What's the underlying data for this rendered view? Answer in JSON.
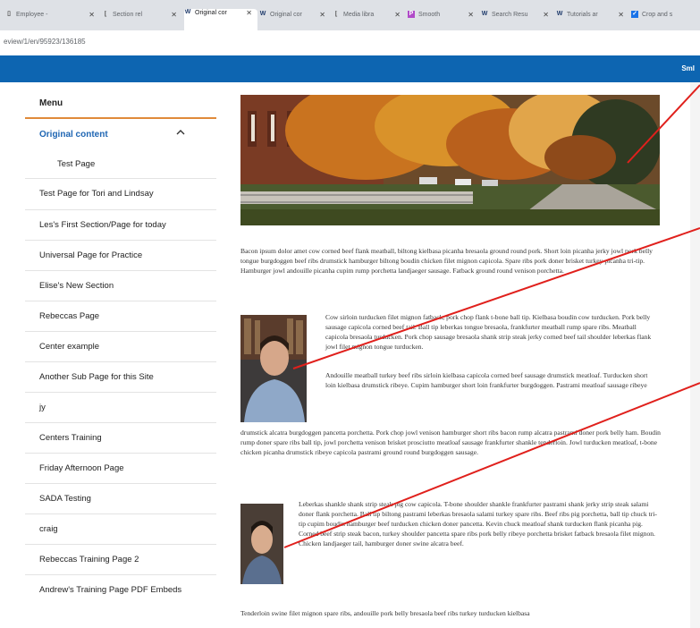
{
  "browser": {
    "tabs": [
      {
        "label": "Employee -",
        "icon": "generic-page-icon"
      },
      {
        "label": "Section rel",
        "icon": "generic-page-icon"
      },
      {
        "label": "Original cor",
        "icon": "wordpress-icon",
        "active": true
      },
      {
        "label": "Original cor",
        "icon": "wordpress-icon"
      },
      {
        "label": "Media libra",
        "icon": "generic-page-icon"
      },
      {
        "label": "Smooth",
        "icon": "smooth-icon"
      },
      {
        "label": "Search Resu",
        "icon": "wordpress-icon"
      },
      {
        "label": "Tutorials ar",
        "icon": "wordpress-icon"
      },
      {
        "label": "Crop and s",
        "icon": "check-icon"
      }
    ],
    "url": "eview/1/en/95923/136185"
  },
  "header": {
    "right_text": "SmI"
  },
  "sidebar": {
    "menu_label": "Menu",
    "section_label": "Original content",
    "sub_item": "Test Page",
    "items": [
      "Test Page for Tori and Lindsay",
      "Les's First Section/Page for today",
      "Universal Page for Practice",
      "Elise's New Section",
      "Rebeccas Page",
      "Center example",
      "Another Sub Page for this Site",
      "jy",
      "Centers Training",
      "Friday Afternoon Page",
      "SADA Testing",
      "craig",
      "Rebeccas Training Page 2",
      "Andrew's Training Page PDF Embeds"
    ]
  },
  "content": {
    "para1": "Bacon ipsum dolor amet cow corned beef flank meatball, biltong kielbasa picanha bresaola ground round pork. Short loin picanha jerky jowl pork belly tongue burgdoggen beef ribs drumstick hamburger biltong boudin chicken filet mignon capicola. Spare ribs pork doner brisket turkey picanha tri-tip. Hamburger jowl andouille picanha cupim rump porchetta landjaeger sausage. Fatback ground round venison porchetta.",
    "para2": "Cow sirloin turducken filet mignon fatback, pork chop flank t-bone ball tip. Kielbasa boudin cow turducken. Pork belly sausage capicola corned beef tail. Ball tip leberkas tongue bresaola, frankfurter meatball rump spare ribs. Meatball capicola bresaola turducken. Pork chop sausage bresaola shank strip steak jerky corned beef tail shoulder leberkas flank jowl filet mignon tongue turducken.",
    "para3a": "Andouille meatball turkey beef ribs sirloin kielbasa capicola corned beef sausage drumstick meatloaf. Turducken short loin kielbasa drumstick ribeye. Cupim hamburger short loin frankfurter burgdoggen. Pastrami meatloaf sausage ribeye",
    "para3b": "drumstick alcatra burgdoggen pancetta porchetta. Pork chop jowl venison hamburger short ribs bacon rump alcatra pastrami doner pork belly ham. Boudin rump doner spare ribs ball tip, jowl porchetta venison brisket prosciutto meatloaf sausage frankfurter shankle tenderloin. Jowl turducken meatloaf, t-bone chicken picanha drumstick ribeye capicola pastrami ground round burgdoggen sausage.",
    "para4": "Leberkas shankle shank strip steak pig cow capicola. T-bone shoulder shankle frankfurter pastrami shank jerky strip steak salami doner flank porchetta. Ball tip biltong pastrami leberkas bresaola salami turkey spare ribs. Beef ribs pig porchetta, ball tip chuck tri-tip cupim boudin hamburger beef turducken chicken doner pancetta. Kevin chuck meatloaf shank turducken flank picanha pig. Corned beef strip steak bacon, turkey shoulder pancetta spare ribs pork belly ribeye porchetta brisket fatback bresaola filet mignon. Chicken landjaeger tail, hamburger doner swine alcatra beef.",
    "para5": "Tenderloin swine filet mignon spare ribs, andouille pork belly bresaola beef ribs turkey turducken kielbasa"
  },
  "colors": {
    "accent_blue": "#0d65b1",
    "menu_rule": "#e08a3a",
    "section_link": "#1f66b3",
    "annotation_red": "#e0201c"
  }
}
